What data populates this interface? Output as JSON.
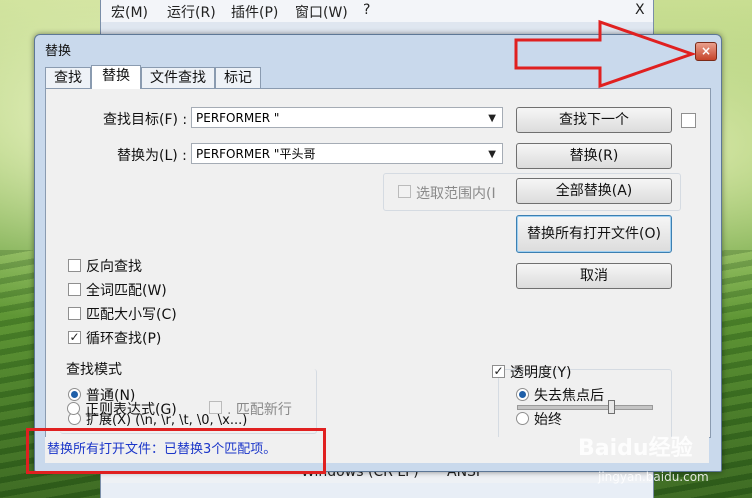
{
  "editor": {
    "menus": [
      "宏(M)",
      "运行(R)",
      "插件(P)",
      "窗口(W)",
      "?"
    ],
    "close_glyph": "X",
    "status_eol": "Windows (CR LF)",
    "status_encoding": "ANSI"
  },
  "dialog": {
    "title": "替换",
    "close_glyph": "×",
    "tabs": [
      "查找",
      "替换",
      "文件查找",
      "标记"
    ],
    "active_tab": 1,
    "find_label": "查找目标(F) :",
    "find_value": "PERFORMER \"",
    "replace_label": "替换为(L) :",
    "replace_value": "PERFORMER \"平头哥",
    "in_selection_label": "选取范围内(I",
    "buttons": {
      "find_next": "查找下一个",
      "replace": "替换(R)",
      "replace_all": "全部替换(A)",
      "replace_all_open": "替换所有打开文件(O)",
      "cancel": "取消"
    },
    "options": [
      {
        "label": "反向查找",
        "checked": false
      },
      {
        "label": "全词匹配(W)",
        "checked": false
      },
      {
        "label": "匹配大小写(C)",
        "checked": false
      },
      {
        "label": "循环查找(P)",
        "checked": true
      }
    ],
    "search_mode": {
      "title": "查找模式",
      "options": [
        {
          "label": "普通(N)",
          "selected": true
        },
        {
          "label": "扩展(X) (\\n, \\r, \\t, \\0, \\x...)",
          "selected": false
        },
        {
          "label": "正则表达式(G)",
          "selected": false
        }
      ],
      "match_newline_label": ". 匹配新行"
    },
    "transparency": {
      "label": "透明度(Y)",
      "checked": true,
      "options": [
        {
          "label": "失去焦点后",
          "selected": true
        },
        {
          "label": "始终",
          "selected": false
        }
      ],
      "slider_value": 0.7
    },
    "status_message": "替换所有打开文件：已替换3个匹配项。"
  },
  "watermark": {
    "brand": "Baidu经验",
    "url": "jingyan.baidu.com"
  },
  "colors": {
    "highlight": "#e02020",
    "status_text": "#1a35c9"
  }
}
